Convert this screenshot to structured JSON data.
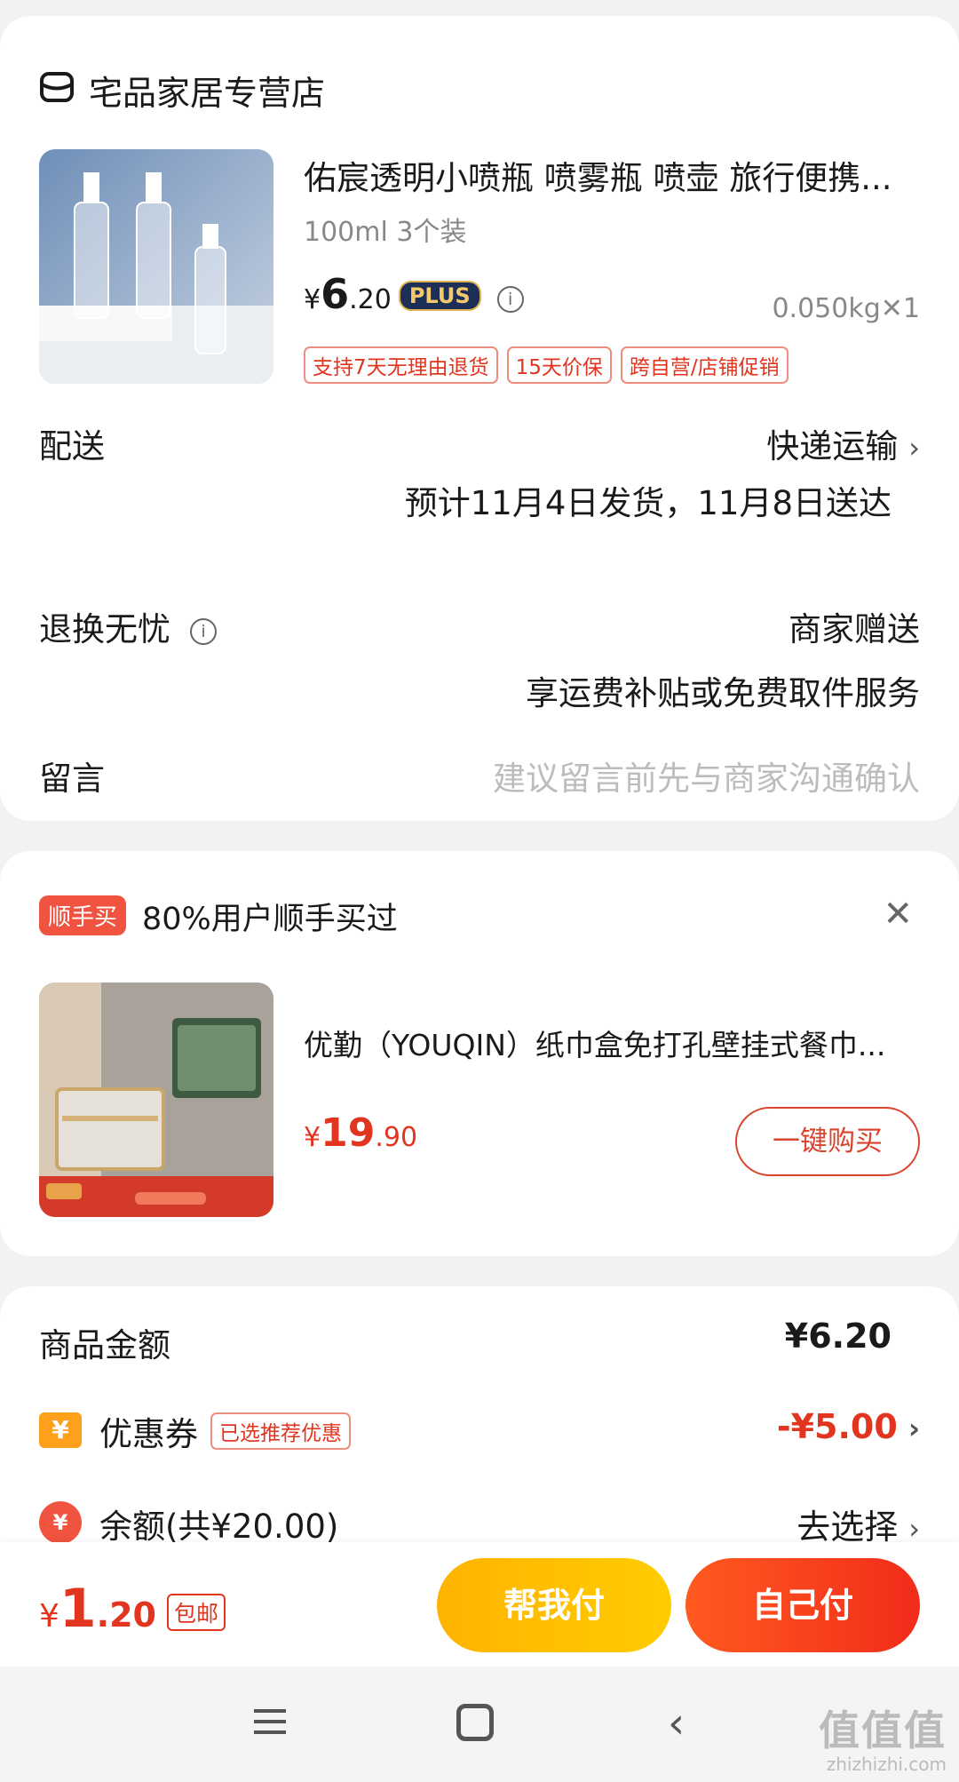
{
  "store": {
    "name": "宅品家居专营店"
  },
  "product": {
    "title": "佑宸透明小喷瓶 喷雾瓶 喷壶 旅行便携...",
    "spec": "100ml 3个装",
    "price_yen": "¥",
    "price_int": "6",
    "price_dec": ".20",
    "plus_badge": "PLUS",
    "weight": "0.050kg✕1",
    "tags": [
      "支持7天无理由退货",
      "15天价保",
      "跨自营/店铺促销"
    ]
  },
  "delivery": {
    "label": "配送",
    "method": "快递运输",
    "estimate": "预计11月4日发货，11月8日送达"
  },
  "returns": {
    "label": "退换无忧",
    "value": "商家赠送",
    "desc": "享运费补贴或免费取件服务"
  },
  "message": {
    "label": "留言",
    "placeholder": "建议留言前先与商家沟通确认"
  },
  "shunshou": {
    "badge": "顺手买",
    "text": "80%用户顺手买过",
    "product_title": "优勤（YOUQIN）纸巾盒免打孔壁挂式餐巾...",
    "price_yen": "¥",
    "price_int": "19",
    "price_dec": ".90",
    "buy_label": "一键购买"
  },
  "summary": {
    "goods_label": "商品金额",
    "goods_value": "¥6.20",
    "coupon_label": "优惠券",
    "coupon_tag": "已选推荐优惠",
    "coupon_value": "-¥5.00",
    "balance_label": "余额(共¥20.00)",
    "balance_value": "去选择"
  },
  "paybar": {
    "total_yen": "¥",
    "total_int": "1",
    "total_dec": ".20",
    "free_ship": "包邮",
    "help_pay": "帮我付",
    "self_pay": "自己付"
  },
  "watermark": {
    "main": "值值值",
    "sub": "zhizhizhi.com"
  },
  "colors": {
    "accent": "#e2351f",
    "help_button": "#ffbf00",
    "pay_button": "#f43b1d"
  }
}
